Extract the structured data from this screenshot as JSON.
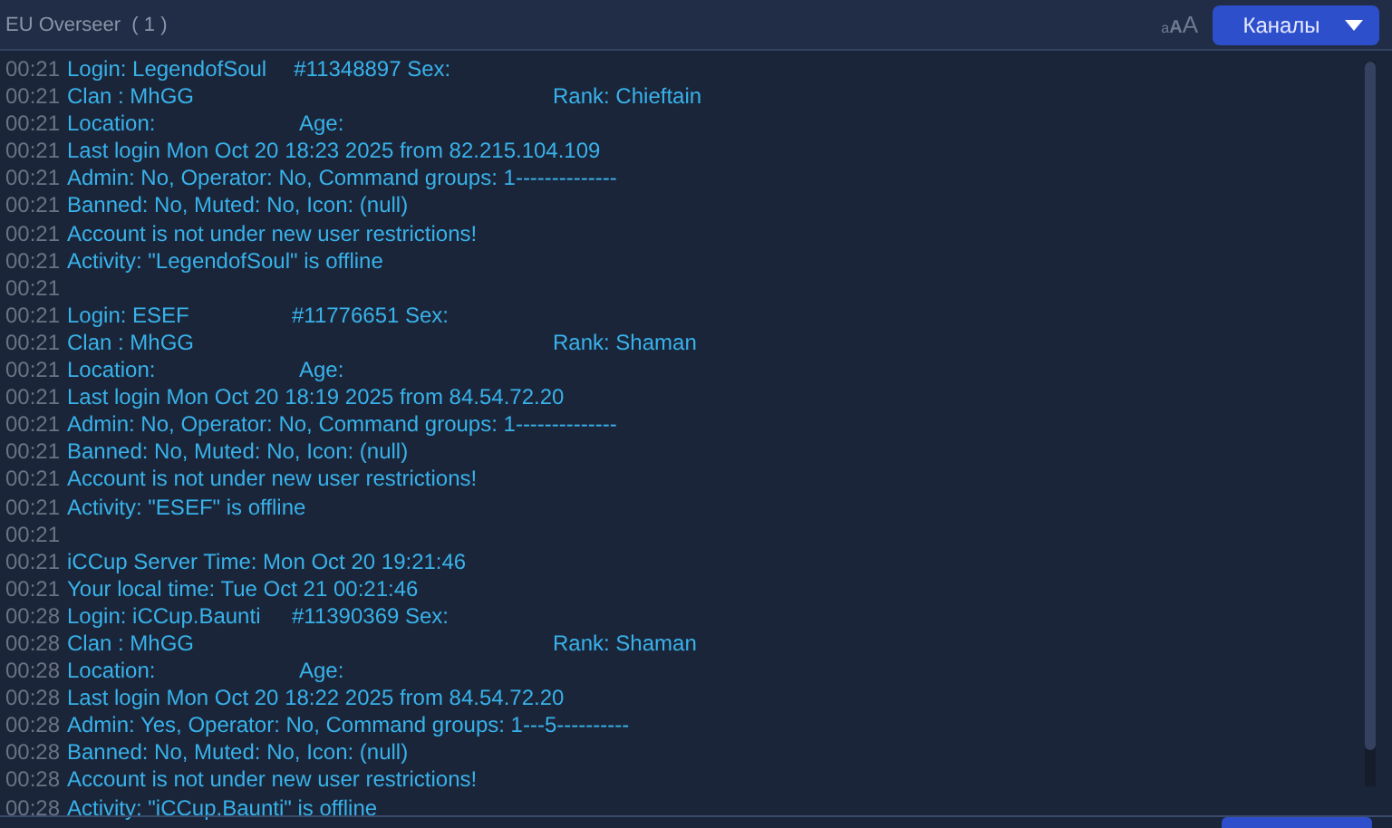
{
  "window": {
    "title": "EU Overseer  ( 1 )"
  },
  "font_size_control": {
    "labels": [
      "a",
      "A",
      "A"
    ]
  },
  "channels_button": {
    "label": "Каналы"
  },
  "log": [
    {
      "time": "00:21",
      "text": "Login: LegendofSoul",
      "tail": "#11348897 Sex:",
      "kind": "id"
    },
    {
      "time": "00:21",
      "text": "Clan : MhGG",
      "tail": "Rank: Chieftain",
      "kind": "rank"
    },
    {
      "time": "00:21",
      "text": "Location:",
      "tail": "Age:",
      "kind": "age"
    },
    {
      "time": "00:21",
      "text": "Last login Mon Oct 20 18:23 2025 from 82.215.104.109"
    },
    {
      "time": "00:21",
      "text": "Admin: No, Operator: No, Command groups: 1--------------"
    },
    {
      "time": "00:21",
      "text": "Banned: No, Muted: No, Icon: (null)"
    },
    {
      "time": "00:21",
      "text": "Account is not under new user restrictions!"
    },
    {
      "time": "00:21",
      "text": "Activity: \"LegendofSoul\" is offline"
    },
    {
      "time": "00:21"
    },
    {
      "time": "00:21",
      "text": "Login: ESEF",
      "tail": "#11776651 Sex:",
      "kind": "id"
    },
    {
      "time": "00:21",
      "text": "Clan : MhGG",
      "tail": "Rank: Shaman",
      "kind": "rank"
    },
    {
      "time": "00:21",
      "text": "Location:",
      "tail": "Age:",
      "kind": "age"
    },
    {
      "time": "00:21",
      "text": "Last login Mon Oct 20 18:19 2025 from 84.54.72.20"
    },
    {
      "time": "00:21",
      "text": "Admin: No, Operator: No, Command groups: 1--------------"
    },
    {
      "time": "00:21",
      "text": "Banned: No, Muted: No, Icon: (null)"
    },
    {
      "time": "00:21",
      "text": "Account is not under new user restrictions!"
    },
    {
      "time": "00:21",
      "text": "Activity: \"ESEF\" is offline"
    },
    {
      "time": "00:21"
    },
    {
      "time": "00:21",
      "text": "iCCup Server Time: Mon Oct 20 19:21:46"
    },
    {
      "time": "00:21",
      "text": "Your local time: Tue Oct 21 00:21:46"
    },
    {
      "time": "00:28",
      "text": "Login: iCCup.Baunti",
      "tail": "#11390369 Sex:",
      "kind": "id"
    },
    {
      "time": "00:28",
      "text": "Clan : MhGG",
      "tail": "Rank: Shaman",
      "kind": "rank"
    },
    {
      "time": "00:28",
      "text": "Location:",
      "tail": "Age:",
      "kind": "age"
    },
    {
      "time": "00:28",
      "text": "Last login Mon Oct 20 18:22 2025 from 84.54.72.20"
    },
    {
      "time": "00:28",
      "text": "Admin: Yes, Operator: No, Command groups: 1---5----------"
    },
    {
      "time": "00:28",
      "text": "Banned: No, Muted: No, Icon: (null)"
    },
    {
      "time": "00:28",
      "text": "Account is not under new user restrictions!"
    },
    {
      "time": "00:28",
      "text": "Activity: \"iCCup.Baunti\" is offline"
    }
  ]
}
